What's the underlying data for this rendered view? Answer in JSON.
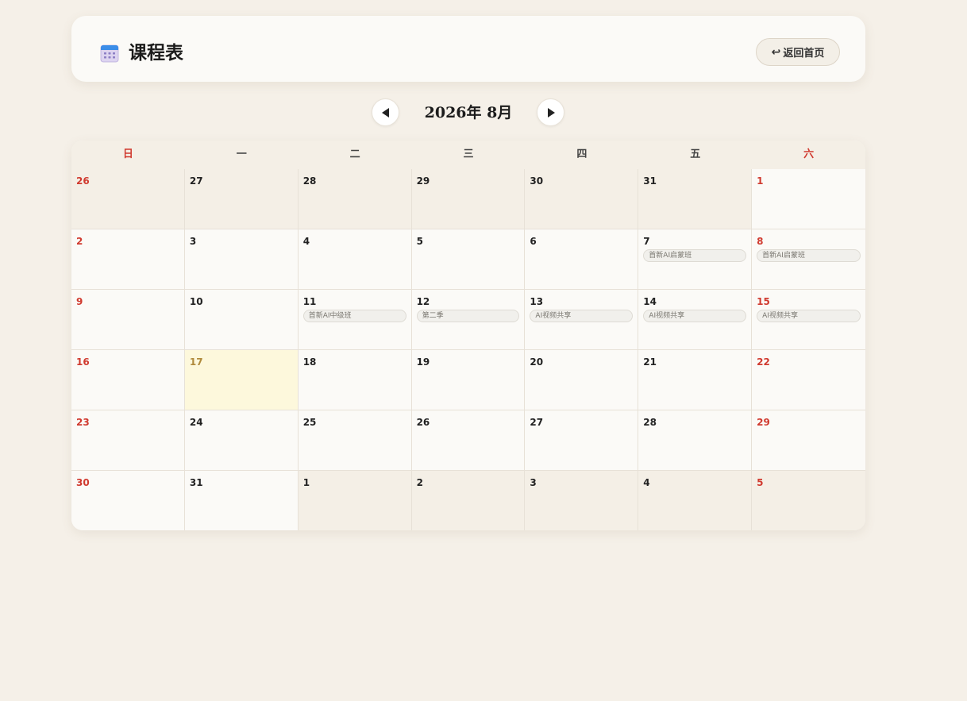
{
  "header": {
    "title": "课程表",
    "icon": "calendar-icon",
    "back_label": "返回首页",
    "back_icon": "return-arrow-icon"
  },
  "nav": {
    "month_label": "2026年 8月",
    "prev_icon": "triangle-left-icon",
    "next_icon": "triangle-right-icon"
  },
  "colors": {
    "background": "#f5f0e8",
    "weekend_text": "#d03a2f",
    "today_bg": "#fdf8dc",
    "other_month_bg": "#f4efe6"
  },
  "weekdays": [
    {
      "label": "日",
      "weekend": true
    },
    {
      "label": "一",
      "weekend": false
    },
    {
      "label": "二",
      "weekend": false
    },
    {
      "label": "三",
      "weekend": false
    },
    {
      "label": "四",
      "weekend": false
    },
    {
      "label": "五",
      "weekend": false
    },
    {
      "label": "六",
      "weekend": true
    }
  ],
  "days": [
    {
      "day": "26",
      "other": true,
      "weekend": true,
      "today": false,
      "events": []
    },
    {
      "day": "27",
      "other": true,
      "weekend": false,
      "today": false,
      "events": []
    },
    {
      "day": "28",
      "other": true,
      "weekend": false,
      "today": false,
      "events": []
    },
    {
      "day": "29",
      "other": true,
      "weekend": false,
      "today": false,
      "events": []
    },
    {
      "day": "30",
      "other": true,
      "weekend": false,
      "today": false,
      "events": []
    },
    {
      "day": "31",
      "other": true,
      "weekend": false,
      "today": false,
      "events": []
    },
    {
      "day": "1",
      "other": false,
      "weekend": true,
      "today": false,
      "events": []
    },
    {
      "day": "2",
      "other": false,
      "weekend": true,
      "today": false,
      "events": []
    },
    {
      "day": "3",
      "other": false,
      "weekend": false,
      "today": false,
      "events": []
    },
    {
      "day": "4",
      "other": false,
      "weekend": false,
      "today": false,
      "events": []
    },
    {
      "day": "5",
      "other": false,
      "weekend": false,
      "today": false,
      "events": []
    },
    {
      "day": "6",
      "other": false,
      "weekend": false,
      "today": false,
      "events": []
    },
    {
      "day": "7",
      "other": false,
      "weekend": false,
      "today": false,
      "events": [
        "首新AI启蒙班"
      ]
    },
    {
      "day": "8",
      "other": false,
      "weekend": true,
      "today": false,
      "events": [
        "首新AI启蒙班"
      ]
    },
    {
      "day": "9",
      "other": false,
      "weekend": true,
      "today": false,
      "events": []
    },
    {
      "day": "10",
      "other": false,
      "weekend": false,
      "today": false,
      "events": []
    },
    {
      "day": "11",
      "other": false,
      "weekend": false,
      "today": false,
      "events": [
        "首新AI中级班"
      ]
    },
    {
      "day": "12",
      "other": false,
      "weekend": false,
      "today": false,
      "events": [
        "第二季"
      ]
    },
    {
      "day": "13",
      "other": false,
      "weekend": false,
      "today": false,
      "events": [
        "AI视频共享"
      ]
    },
    {
      "day": "14",
      "other": false,
      "weekend": false,
      "today": false,
      "events": [
        "AI视频共享"
      ]
    },
    {
      "day": "15",
      "other": false,
      "weekend": true,
      "today": false,
      "events": [
        "AI视频共享"
      ]
    },
    {
      "day": "16",
      "other": false,
      "weekend": true,
      "today": false,
      "events": []
    },
    {
      "day": "17",
      "other": false,
      "weekend": false,
      "today": true,
      "events": []
    },
    {
      "day": "18",
      "other": false,
      "weekend": false,
      "today": false,
      "events": []
    },
    {
      "day": "19",
      "other": false,
      "weekend": false,
      "today": false,
      "events": []
    },
    {
      "day": "20",
      "other": false,
      "weekend": false,
      "today": false,
      "events": []
    },
    {
      "day": "21",
      "other": false,
      "weekend": false,
      "today": false,
      "events": []
    },
    {
      "day": "22",
      "other": false,
      "weekend": true,
      "today": false,
      "events": []
    },
    {
      "day": "23",
      "other": false,
      "weekend": true,
      "today": false,
      "events": []
    },
    {
      "day": "24",
      "other": false,
      "weekend": false,
      "today": false,
      "events": []
    },
    {
      "day": "25",
      "other": false,
      "weekend": false,
      "today": false,
      "events": []
    },
    {
      "day": "26",
      "other": false,
      "weekend": false,
      "today": false,
      "events": []
    },
    {
      "day": "27",
      "other": false,
      "weekend": false,
      "today": false,
      "events": []
    },
    {
      "day": "28",
      "other": false,
      "weekend": false,
      "today": false,
      "events": []
    },
    {
      "day": "29",
      "other": false,
      "weekend": true,
      "today": false,
      "events": []
    },
    {
      "day": "30",
      "other": false,
      "weekend": true,
      "today": false,
      "events": []
    },
    {
      "day": "31",
      "other": false,
      "weekend": false,
      "today": false,
      "events": []
    },
    {
      "day": "1",
      "other": true,
      "weekend": false,
      "today": false,
      "events": []
    },
    {
      "day": "2",
      "other": true,
      "weekend": false,
      "today": false,
      "events": []
    },
    {
      "day": "3",
      "other": true,
      "weekend": false,
      "today": false,
      "events": []
    },
    {
      "day": "4",
      "other": true,
      "weekend": false,
      "today": false,
      "events": []
    },
    {
      "day": "5",
      "other": true,
      "weekend": true,
      "today": false,
      "events": []
    }
  ]
}
